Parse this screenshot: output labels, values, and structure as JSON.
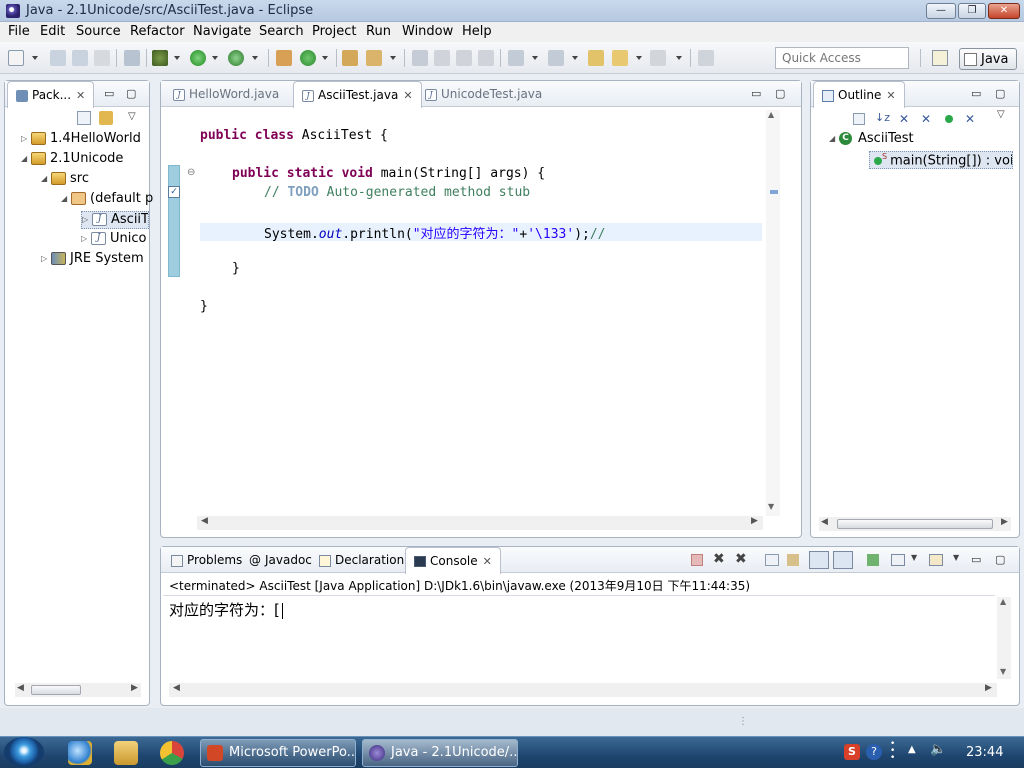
{
  "window": {
    "title": "Java - 2.1Unicode/src/AsciiTest.java - Eclipse",
    "min": "—",
    "max": "❐",
    "close": "✕"
  },
  "menubar": [
    "File",
    "Edit",
    "Source",
    "Refactor",
    "Navigate",
    "Search",
    "Project",
    "Run",
    "Window",
    "Help"
  ],
  "toolbar": {
    "quick_access_placeholder": "Quick Access",
    "perspective": "Java"
  },
  "package_explorer": {
    "tab": "Pack...",
    "tree": [
      {
        "label": "1.4HelloWorld"
      },
      {
        "label": "2.1Unicode"
      },
      {
        "label": "src"
      },
      {
        "label": "(default p"
      },
      {
        "label": "AsciiT"
      },
      {
        "label": "Unico"
      },
      {
        "label": "JRE System"
      }
    ]
  },
  "editor": {
    "tabs": [
      {
        "label": "HelloWord.java"
      },
      {
        "label": "AsciiTest.java"
      },
      {
        "label": "UnicodeTest.java"
      }
    ],
    "code": {
      "l1_kw": "public class ",
      "l1_rest": "AsciiTest {",
      "l2_kw": "public static void ",
      "l2_rest": "main(String[] args) {",
      "l3_pre": "// ",
      "l3_todo": "TODO",
      "l3_post": " Auto-generated method stub",
      "l4_a": "System.",
      "l4_out": "out",
      "l4_b": ".println(",
      "l4_str1": "\"对应的字符为：\"",
      "l4_plus": "+",
      "l4_str2": "'\\133'",
      "l4_c": ");",
      "l4_cm": "//",
      "l5": "}",
      "l6": "}"
    }
  },
  "outline": {
    "tab": "Outline",
    "class_name": "AsciiTest",
    "method": "main(String[]) : void",
    "static_marker": "S"
  },
  "console": {
    "tabs": [
      {
        "label": "Problems",
        "icon": "problems-icon"
      },
      {
        "label": "Javadoc",
        "icon": "@"
      },
      {
        "label": "Declaration",
        "icon": "declaration-icon"
      },
      {
        "label": "Console",
        "icon": "console-icon"
      }
    ],
    "status": "<terminated> AsciiTest [Java Application] D:\\JDk1.6\\bin\\javaw.exe (2013年9月10日 下午11:44:35)",
    "output": "对应的字符为：["
  },
  "taskbar": {
    "apps": [
      {
        "label": "Microsoft PowerPo..."
      },
      {
        "label": "Java - 2.1Unicode/..."
      }
    ],
    "clock": "23:44"
  },
  "colors": {
    "keyword": "#7f0055",
    "comment": "#3f7f5f",
    "string": "#2a00ff",
    "field": "#0000c0",
    "todo": "#7f9fbf"
  }
}
